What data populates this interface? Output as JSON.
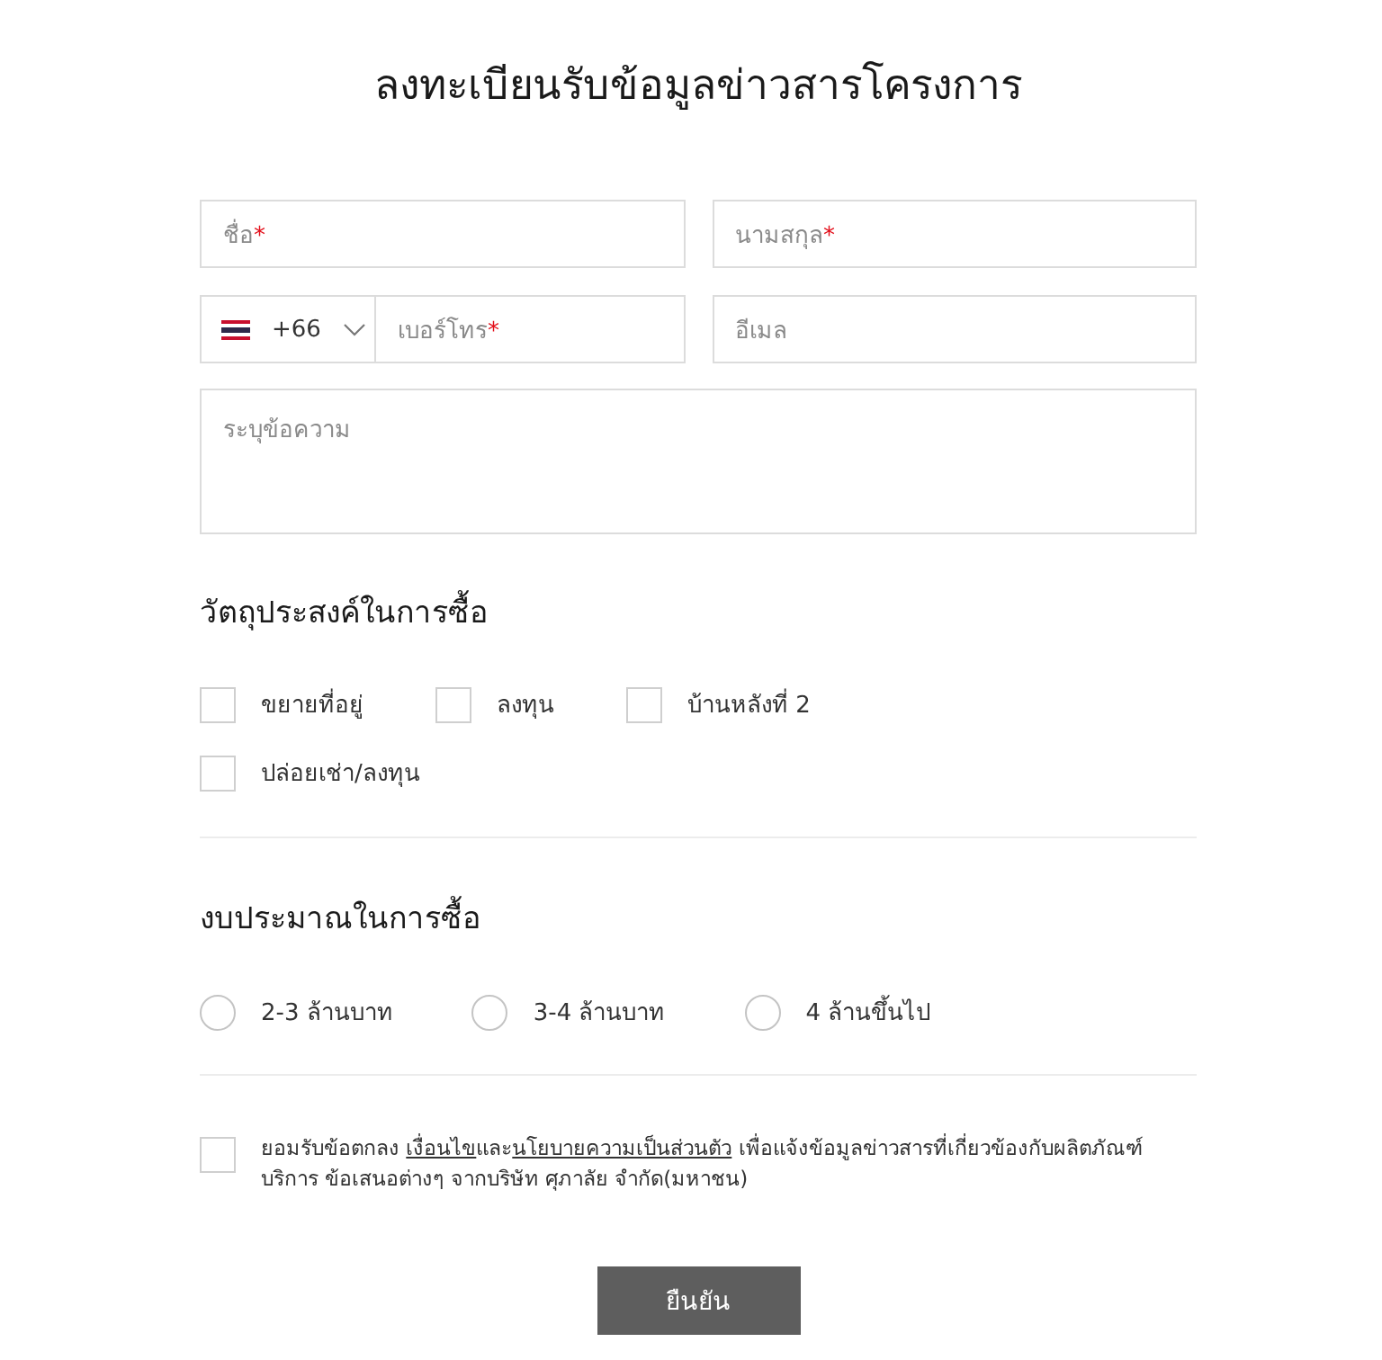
{
  "title": "ลงทะเบียนรับข้อมูลข่าวสารโครงการ",
  "first_name": {
    "placeholder": "ชื่อ",
    "marker": "*"
  },
  "last_name": {
    "placeholder": "นามสกุล",
    "marker": "*"
  },
  "phone": {
    "country_code": "+66",
    "placeholder": "เบอร์โทร",
    "marker": "*"
  },
  "email": {
    "placeholder": "อีเมล"
  },
  "message": {
    "placeholder": "ระบุข้อความ"
  },
  "purpose": {
    "heading": "วัตถุประสงค์ในการซื้อ",
    "options": [
      {
        "label": "ขยายที่อยู่",
        "checked": false
      },
      {
        "label": "ลงทุน",
        "checked": false
      },
      {
        "label": "บ้านหลังที่ 2",
        "checked": false
      },
      {
        "label": "ปล่อยเช่า/ลงทุน",
        "checked": false
      }
    ]
  },
  "budget": {
    "heading": "งบประมาณในการซื้อ",
    "options": [
      {
        "label": "2-3 ล้านบาท",
        "selected": false
      },
      {
        "label": "3-4 ล้านบาท",
        "selected": false
      },
      {
        "label": "4 ล้านขึ้นไป",
        "selected": false
      }
    ]
  },
  "consent": {
    "checked": false,
    "parts": [
      {
        "kind": "text",
        "text": "ยอมรับข้อตกลง "
      },
      {
        "kind": "link",
        "text": "เงื่อนไข"
      },
      {
        "kind": "text",
        "text": "และ"
      },
      {
        "kind": "link",
        "text": "นโยบายความเป็นส่วนตัว"
      },
      {
        "kind": "text",
        "text": " เพื่อแจ้งข้อมูลข่าวสารที่เกี่ยวข้องกับผลิตภัณฑ์ บริการ ข้อเสนอต่างๆ จากบริษัท ศุภาลัย จำกัด(มหาชน)"
      }
    ]
  },
  "submit": "ยืนยัน"
}
